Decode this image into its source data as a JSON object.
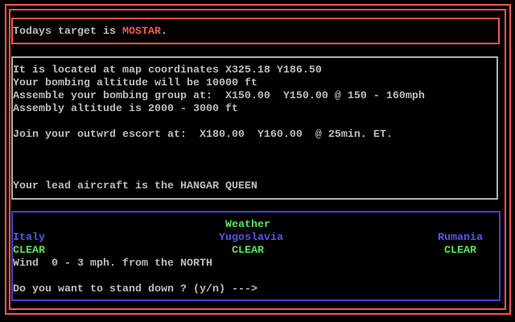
{
  "screen": {
    "background": "#000000"
  },
  "colors": {
    "border_red": "#f4564e",
    "text_gray": "#bcbcbc",
    "border_gray": "#b0b0b0",
    "green": "#58e658",
    "blue_text": "#5956e8",
    "border_blue": "#4340d4"
  },
  "target_box": {
    "prefix": "Todays target is ",
    "target_name": "MOSTAR",
    "suffix": "."
  },
  "briefing_box": {
    "coordinates_line": "It is located at map coordinates X325.18 Y186.50",
    "bombing_altitude_line": "Your bombing altitude will be 10000 ft",
    "assembly_point_line": "Assemble your bombing group at:  X150.00  Y150.00 @ 150 - 160mph",
    "assembly_altitude_line": "Assembly altitude is 2000 - 3000 ft",
    "escort_line": "Join your outwrd escort at:  X180.00  Y160.00  @ 25min. ET.",
    "lead_aircraft_line": "Your lead aircraft is the HANGAR QUEEN"
  },
  "weather_box": {
    "title": "Weather",
    "regions": [
      {
        "name": "Italy",
        "status": "CLEAR"
      },
      {
        "name": "Yugoslavia",
        "status": "CLEAR"
      },
      {
        "name": "Rumania",
        "status": "CLEAR"
      }
    ],
    "wind_line": "Wind  0 - 3 mph. from the NORTH",
    "prompt": "Do you want to stand down ? (y/n) --->"
  }
}
